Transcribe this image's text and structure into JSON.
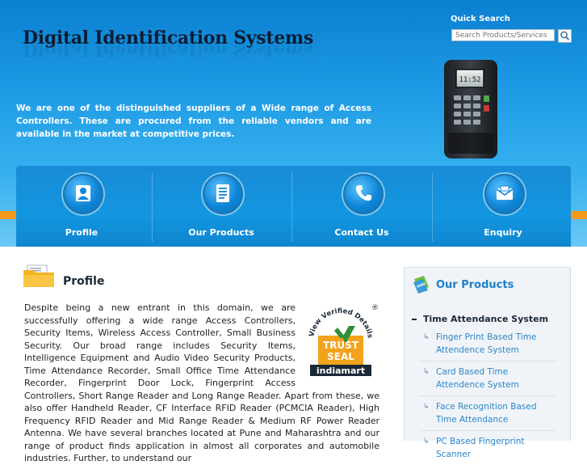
{
  "header": {
    "brand": "Digital Identification Systems",
    "intro": "We are one of the distinguished suppliers of a Wide range of Access Controllers. These are procured from the reliable vendors and are available in the market at competitive prices.",
    "device_display": "11:52",
    "colors": {
      "header_top": "#0a7fd0",
      "header_bottom": "#6cc8f4",
      "accent_band": "#f29a1e"
    }
  },
  "quick_search": {
    "label": "Quick Search",
    "placeholder": "Search Products/Services",
    "button_icon": "search-icon"
  },
  "nav": [
    {
      "label": "Profile",
      "icon": "user-icon"
    },
    {
      "label": "Our Products",
      "icon": "document-icon"
    },
    {
      "label": "Contact Us",
      "icon": "phone-icon"
    },
    {
      "label": "Enquiry",
      "icon": "mail-icon"
    }
  ],
  "profile": {
    "title": "Profile",
    "text": "Despite being a new entrant in this domain, we are successfully offering a wide range Access Controllers, Security Items, Wireless Access Controller, Small Business Security. Our broad range includes Security Items, Intelligence Equipment and Audio Video Security Products, Time Attendance Recorder, Small Office Time Attendance Recorder, Fingerprint Door Lock, Fingerprint Access Controllers, Short Range Reader and Long Range Reader. Apart from these, we also offer Handheld Reader, CF Interface RFID Reader (PCMCIA Reader), High Frequency RFID Reader and Mid Range Reader & Medium RF Power Reader Antenna. We have several branches located at Pune and Maharashtra and our range of product finds application in almost all corporates and automobile industries. Further, to understand our",
    "seal": {
      "arc_text": "View Verified Details",
      "registered": "®",
      "line1": "TRUST",
      "line2": "SEAL",
      "brand": "indiamart"
    }
  },
  "sidebar": {
    "title": "Our Products",
    "category": "Time Attendance System",
    "items": [
      "Finger Print Based Time Attendence System",
      "Card Based Time Attendence System",
      "Face Recognition Based Time Attendance",
      "PC Based Fingerprint Scanner"
    ]
  }
}
